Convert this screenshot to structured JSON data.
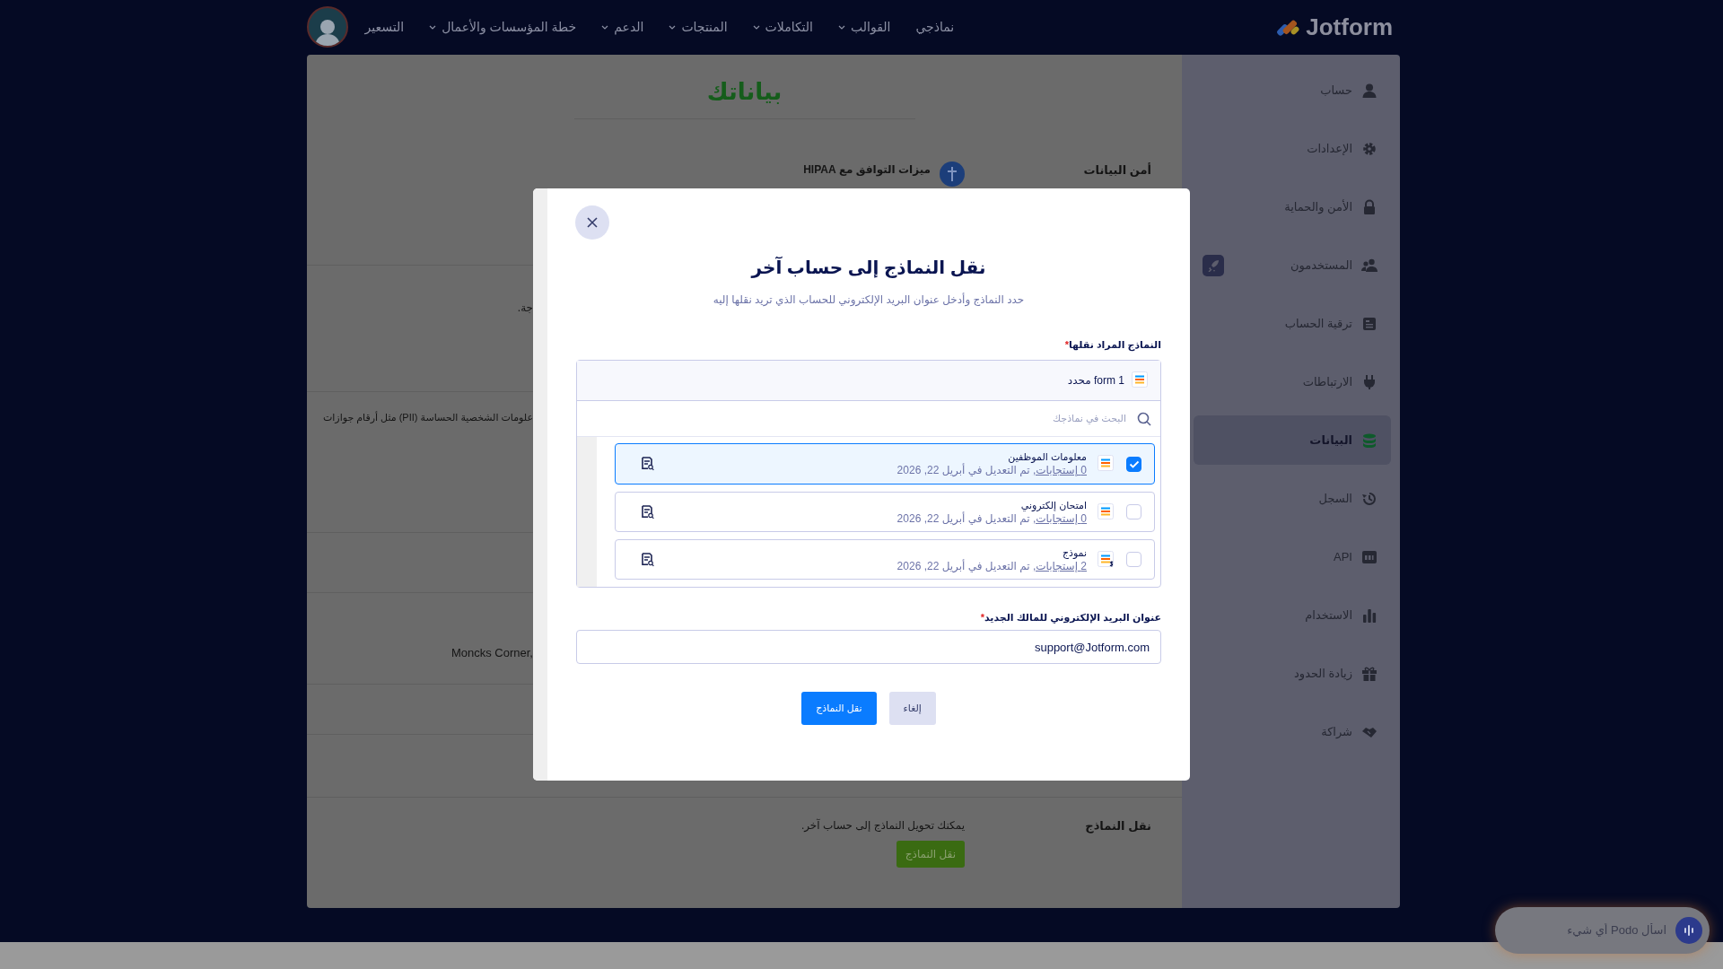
{
  "nav": {
    "logo_text": "Jotform",
    "items": [
      {
        "label": "نماذجي",
        "dropdown": false
      },
      {
        "label": "القوالب",
        "dropdown": true
      },
      {
        "label": "التكاملات",
        "dropdown": true
      },
      {
        "label": "المنتجات",
        "dropdown": true
      },
      {
        "label": "الدعم",
        "dropdown": true
      },
      {
        "label": "خطة المؤسسات والأعمال",
        "dropdown": true
      },
      {
        "label": "التسعير",
        "dropdown": false
      }
    ]
  },
  "sidebar": {
    "items": [
      {
        "label": "حساب",
        "selected": false,
        "upgrade_badge": false
      },
      {
        "label": "الإعدادات",
        "selected": false,
        "upgrade_badge": false
      },
      {
        "label": "الأمن والحماية",
        "selected": false,
        "upgrade_badge": false
      },
      {
        "label": "المستخدمون",
        "selected": false,
        "upgrade_badge": true
      },
      {
        "label": "ترقية الحساب",
        "selected": false,
        "upgrade_badge": false
      },
      {
        "label": "الارتباطات",
        "selected": false,
        "upgrade_badge": false
      },
      {
        "label": "البيانات",
        "selected": true,
        "upgrade_badge": false
      },
      {
        "label": "السجل",
        "selected": false,
        "upgrade_badge": false
      },
      {
        "label": "API",
        "selected": false,
        "upgrade_badge": false
      },
      {
        "label": "الاستخدام",
        "selected": false,
        "upgrade_badge": false
      },
      {
        "label": "زيادة الحدود",
        "selected": false,
        "upgrade_badge": false
      },
      {
        "label": "شراكة",
        "selected": false,
        "upgrade_badge": false
      }
    ]
  },
  "page": {
    "title": "بياناتك",
    "security_heading": "أمن البيانات",
    "hipaa_feature": "ميزات التوافق مع HIPAA",
    "cut_texts": [
      "جة.",
      "علومات الشخصية الحساسة (PII) مثل أرقام جوازات",
      "Moncks Corner,"
    ],
    "transfer": {
      "heading": "نقل النماذج",
      "description": "يمكنك تحويل النماذج إلى حساب آخر.",
      "button": "نقل النماذج"
    }
  },
  "modal": {
    "title": "نقل النماذج إلى حساب آخر",
    "subtitle": "حدد النماذج وأدخل عنوان البريد الإلكتروني للحساب الذي تريد نقلها إليه",
    "forms_label": "النماذج المراد نقلها",
    "forms_required": "*",
    "selected_count": "1 form محدد",
    "search": {
      "placeholder": "البحث في نماذجك"
    },
    "forms": [
      {
        "title": "معلومات الموظفين",
        "responses": "0 إستجابات,",
        "modified": "تم التعديل في أبريل 22, 2026",
        "kind": "standard",
        "checked": true
      },
      {
        "title": "امتحان إلكتروني",
        "responses": "0 إستجابات,",
        "modified": "تم التعديل في أبريل 22, 2026",
        "kind": "standard",
        "checked": false
      },
      {
        "title": "نموذج",
        "responses": "2 إستجابات,",
        "modified": "تم التعديل في أبريل 22, 2026",
        "kind": "payment",
        "checked": false
      }
    ],
    "email_label": "عنوان البريد الإلكتروني للمالك الجديد",
    "email_required": "*",
    "email": {
      "value": "support@Jotform.com"
    },
    "buttons": {
      "cancel": "إلغاء",
      "submit": "نقل النماذج"
    }
  },
  "chat": {
    "placeholder": "اسأل Podo أي شيء"
  }
}
